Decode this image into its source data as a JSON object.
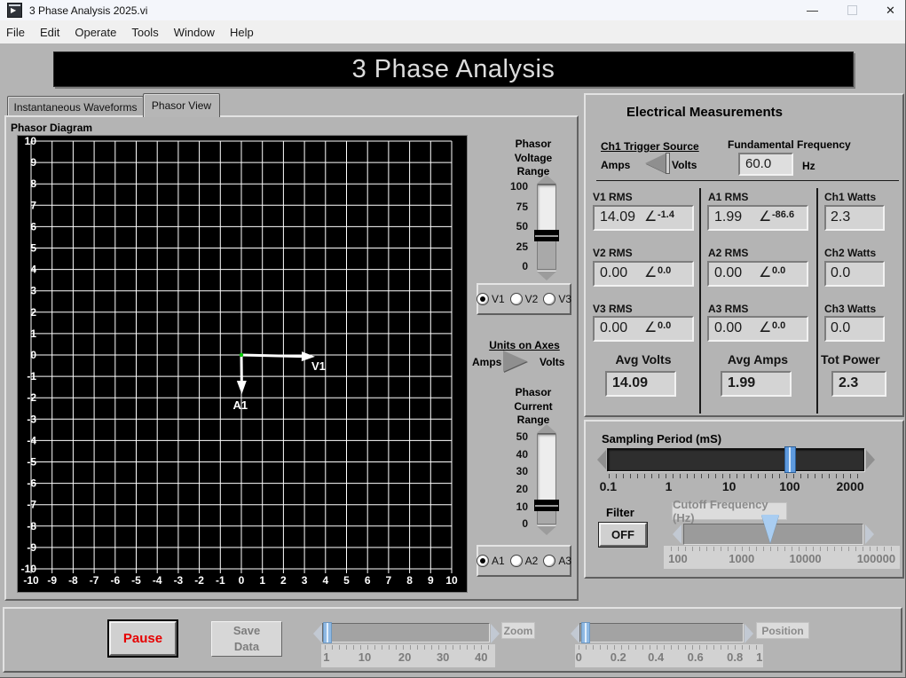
{
  "window": {
    "title": "3 Phase Analysis 2025.vi",
    "minimize": "—",
    "close": "✕"
  },
  "menu": {
    "items": [
      "File",
      "Edit",
      "Operate",
      "Tools",
      "Window",
      "Help"
    ]
  },
  "banner": {
    "title": "3 Phase Analysis"
  },
  "tabs": {
    "tab1": "Instantaneous Waveforms",
    "tab2": "Phasor View"
  },
  "phasor": {
    "section_label": "Phasor Diagram",
    "voltage_range": {
      "label": "Phasor\nVoltage\nRange",
      "scale": [
        "100",
        "75",
        "50",
        "25",
        "0"
      ],
      "value": 40
    },
    "voltage_select": {
      "options": [
        "V1",
        "V2",
        "V3"
      ],
      "selected": "V1"
    },
    "units_on_axes": {
      "label": "Units on Axes",
      "left": "Amps",
      "right": "Volts"
    },
    "current_range": {
      "label": "Phasor\nCurrent\nRange",
      "scale": [
        "50",
        "40",
        "30",
        "20",
        "10",
        "0"
      ],
      "value": 10
    },
    "current_select": {
      "options": [
        "A1",
        "A2",
        "A3"
      ],
      "selected": "A1"
    }
  },
  "chart_data": {
    "type": "line",
    "title": "Phasor Diagram",
    "xlabel": "",
    "ylabel": "",
    "xlim": [
      -10,
      10
    ],
    "ylim": [
      -10,
      10
    ],
    "grid": true,
    "x_ticks": [
      -10,
      -9,
      -8,
      -7,
      -6,
      -5,
      -4,
      -3,
      -2,
      -1,
      0,
      1,
      2,
      3,
      4,
      5,
      6,
      7,
      8,
      9,
      10
    ],
    "y_ticks": [
      -10,
      -9,
      -8,
      -7,
      -6,
      -5,
      -4,
      -3,
      -2,
      -1,
      0,
      1,
      2,
      3,
      4,
      5,
      6,
      7,
      8,
      9,
      10
    ],
    "series": [
      {
        "name": "V1",
        "kind": "phasor-vector",
        "from": [
          0,
          0
        ],
        "to": [
          3.5,
          -0.08
        ],
        "magnitude_rms": 14.09,
        "angle_deg": -1.4,
        "color": "#ffffff",
        "label_dx": -4,
        "label_dy": 15
      },
      {
        "name": "A1",
        "kind": "phasor-vector",
        "from": [
          0,
          0
        ],
        "to": [
          0.02,
          -1.83
        ],
        "magnitude_rms": 1.99,
        "angle_deg": -86.6,
        "color": "#ffffff",
        "label_dx": -10,
        "label_dy": 17
      }
    ],
    "origin_marker_color": "#00cc00"
  },
  "measurements": {
    "title": "Electrical Measurements",
    "angle_symbol": "∠",
    "trigger": {
      "label": "Ch1 Trigger Source",
      "left": "Amps",
      "right": "Volts"
    },
    "frequency": {
      "label": "Fundamental Frequency",
      "value": "60.0",
      "unit": "Hz"
    },
    "v": [
      {
        "label": "V1 RMS",
        "value": "14.09",
        "angle": "-1.4"
      },
      {
        "label": "V2 RMS",
        "value": "0.00",
        "angle": "0.0"
      },
      {
        "label": "V3 RMS",
        "value": "0.00",
        "angle": "0.0"
      }
    ],
    "a": [
      {
        "label": "A1 RMS",
        "value": "1.99",
        "angle": "-86.6"
      },
      {
        "label": "A2 RMS",
        "value": "0.00",
        "angle": "0.0"
      },
      {
        "label": "A3 RMS",
        "value": "0.00",
        "angle": "0.0"
      }
    ],
    "w": [
      {
        "label": "Ch1 Watts",
        "value": "2.3"
      },
      {
        "label": "Ch2 Watts",
        "value": "0.0"
      },
      {
        "label": "Ch3 Watts",
        "value": "0.0"
      }
    ],
    "avg": [
      {
        "label": "Avg Volts",
        "value": "14.09"
      },
      {
        "label": "Avg Amps",
        "value": "1.99"
      },
      {
        "label": "Tot Power",
        "value": "2.3"
      }
    ]
  },
  "sampling": {
    "label": "Sampling Period (mS)",
    "scale": [
      "0.1",
      "1",
      "10",
      "100",
      "2000"
    ],
    "value": "100"
  },
  "filter": {
    "label": "Filter",
    "button": "OFF"
  },
  "cutoff": {
    "label": "Cutoff Frequency (Hz)",
    "scale": [
      "100",
      "1000",
      "10000",
      "100000"
    ]
  },
  "footer": {
    "pause": "Pause",
    "save": "Save\nData",
    "zoom": {
      "label": "Zoom",
      "scale": [
        "1",
        "10",
        "20",
        "30",
        "40"
      ]
    },
    "position": {
      "label": "Position",
      "scale": [
        "0",
        "0.2",
        "0.4",
        "0.6",
        "0.8",
        "1"
      ]
    }
  }
}
